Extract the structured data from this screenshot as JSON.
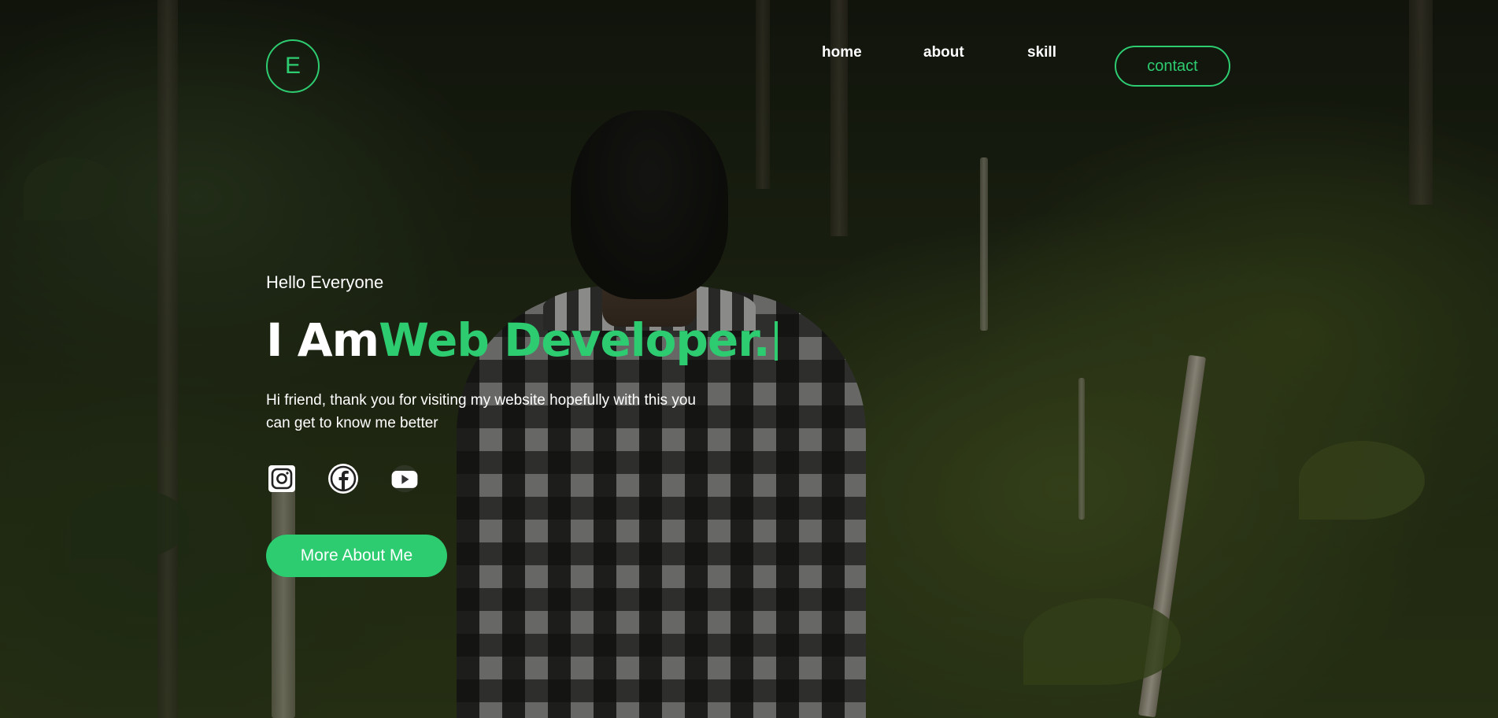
{
  "brand": {
    "logo_letter": "E"
  },
  "nav": {
    "items": [
      {
        "label": "home"
      },
      {
        "label": "about"
      },
      {
        "label": "skill"
      }
    ],
    "contact_label": "contact"
  },
  "hero": {
    "greeting": "Hello Everyone",
    "headline_lead": "I Am",
    "headline_role": "Web Developer.",
    "intro": "Hi friend, thank you for visiting my website hopefully with this you can get to know me better",
    "cta_label": "More About Me"
  },
  "socials": [
    {
      "icon": "instagram-icon"
    },
    {
      "icon": "facebook-icon"
    },
    {
      "icon": "youtube-icon"
    }
  ],
  "colors": {
    "accent": "#2ecc71",
    "text": "#ffffff"
  }
}
